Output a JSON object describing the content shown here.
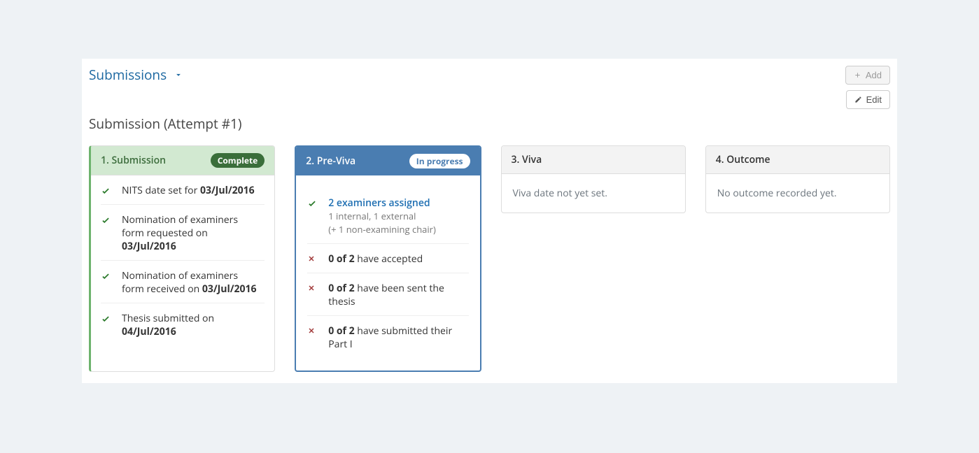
{
  "header": {
    "section_title": "Submissions",
    "add_label": "Add",
    "edit_label": "Edit",
    "subtitle": "Submission (Attempt #1)"
  },
  "cards": {
    "submission": {
      "title": "1. Submission",
      "badge": "Complete",
      "items": [
        {
          "text_prefix": "NITS date set for",
          "bold": "03/Jul/2016"
        },
        {
          "text_prefix": "Nomination of examiners form requested on",
          "bold": "03/Jul/2016"
        },
        {
          "text_prefix": "Nomination of examiners form received on",
          "bold": "03/Jul/2016"
        },
        {
          "text_prefix": "Thesis submitted on",
          "bold": "04/Jul/2016"
        }
      ]
    },
    "previva": {
      "title": "2. Pre-Viva",
      "badge": "In progress",
      "examiners": {
        "bold": "2",
        "link_suffix": "examiners assigned",
        "sub1": "1 internal, 1 external",
        "sub2": "(+ 1 non-examining chair)"
      },
      "rows": [
        {
          "bold": "0 of 2",
          "rest": " have accepted"
        },
        {
          "bold": "0 of 2",
          "rest": " have been sent the thesis"
        },
        {
          "bold": "0 of 2",
          "rest": " have submitted their Part I"
        }
      ]
    },
    "viva": {
      "title": "3. Viva",
      "placeholder": "Viva date not yet set."
    },
    "outcome": {
      "title": "4. Outcome",
      "placeholder": "No outcome recorded yet."
    }
  }
}
